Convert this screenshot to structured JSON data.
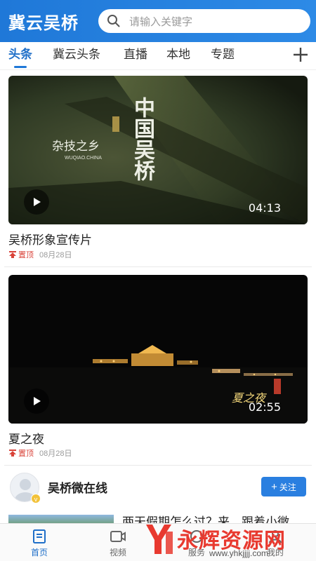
{
  "header": {
    "app_title": "冀云吴桥",
    "search_placeholder": "请输入关键字"
  },
  "tabs": [
    {
      "label": "头条",
      "active": true
    },
    {
      "label": "冀云头条",
      "active": false
    },
    {
      "label": "直播",
      "active": false
    },
    {
      "label": "本地",
      "active": false
    },
    {
      "label": "专题",
      "active": false
    }
  ],
  "videos": [
    {
      "title": "吴桥形象宣传片",
      "duration": "04:13",
      "pin_label": "置顶",
      "date": "08月28日",
      "overlay_big": "中国吴桥",
      "overlay_sub": "杂技之乡",
      "overlay_en": "WUQIAO.CHINA"
    },
    {
      "title": "夏之夜",
      "duration": "02:55",
      "pin_label": "置顶",
      "date": "08月28日",
      "overlay_big": "夏之夜"
    }
  ],
  "channel": {
    "name": "吴桥微在线",
    "follow_label": "关注",
    "badge": "v"
  },
  "news": {
    "title": "两天假期怎么过？来，跟着小微"
  },
  "bottom_nav": [
    {
      "label": "首页",
      "icon": "home-book-icon",
      "active": true
    },
    {
      "label": "视频",
      "icon": "video-icon",
      "active": false
    },
    {
      "label": "服务",
      "icon": "service-icon",
      "active": false
    },
    {
      "label": "我的",
      "icon": "user-icon",
      "active": false
    }
  ],
  "watermark": {
    "text": "永辉资源网",
    "url": "www.yhkjjjj.com"
  },
  "colors": {
    "brand": "#1f78d8",
    "pin": "#d9443a",
    "watermark": "#e8392f"
  }
}
